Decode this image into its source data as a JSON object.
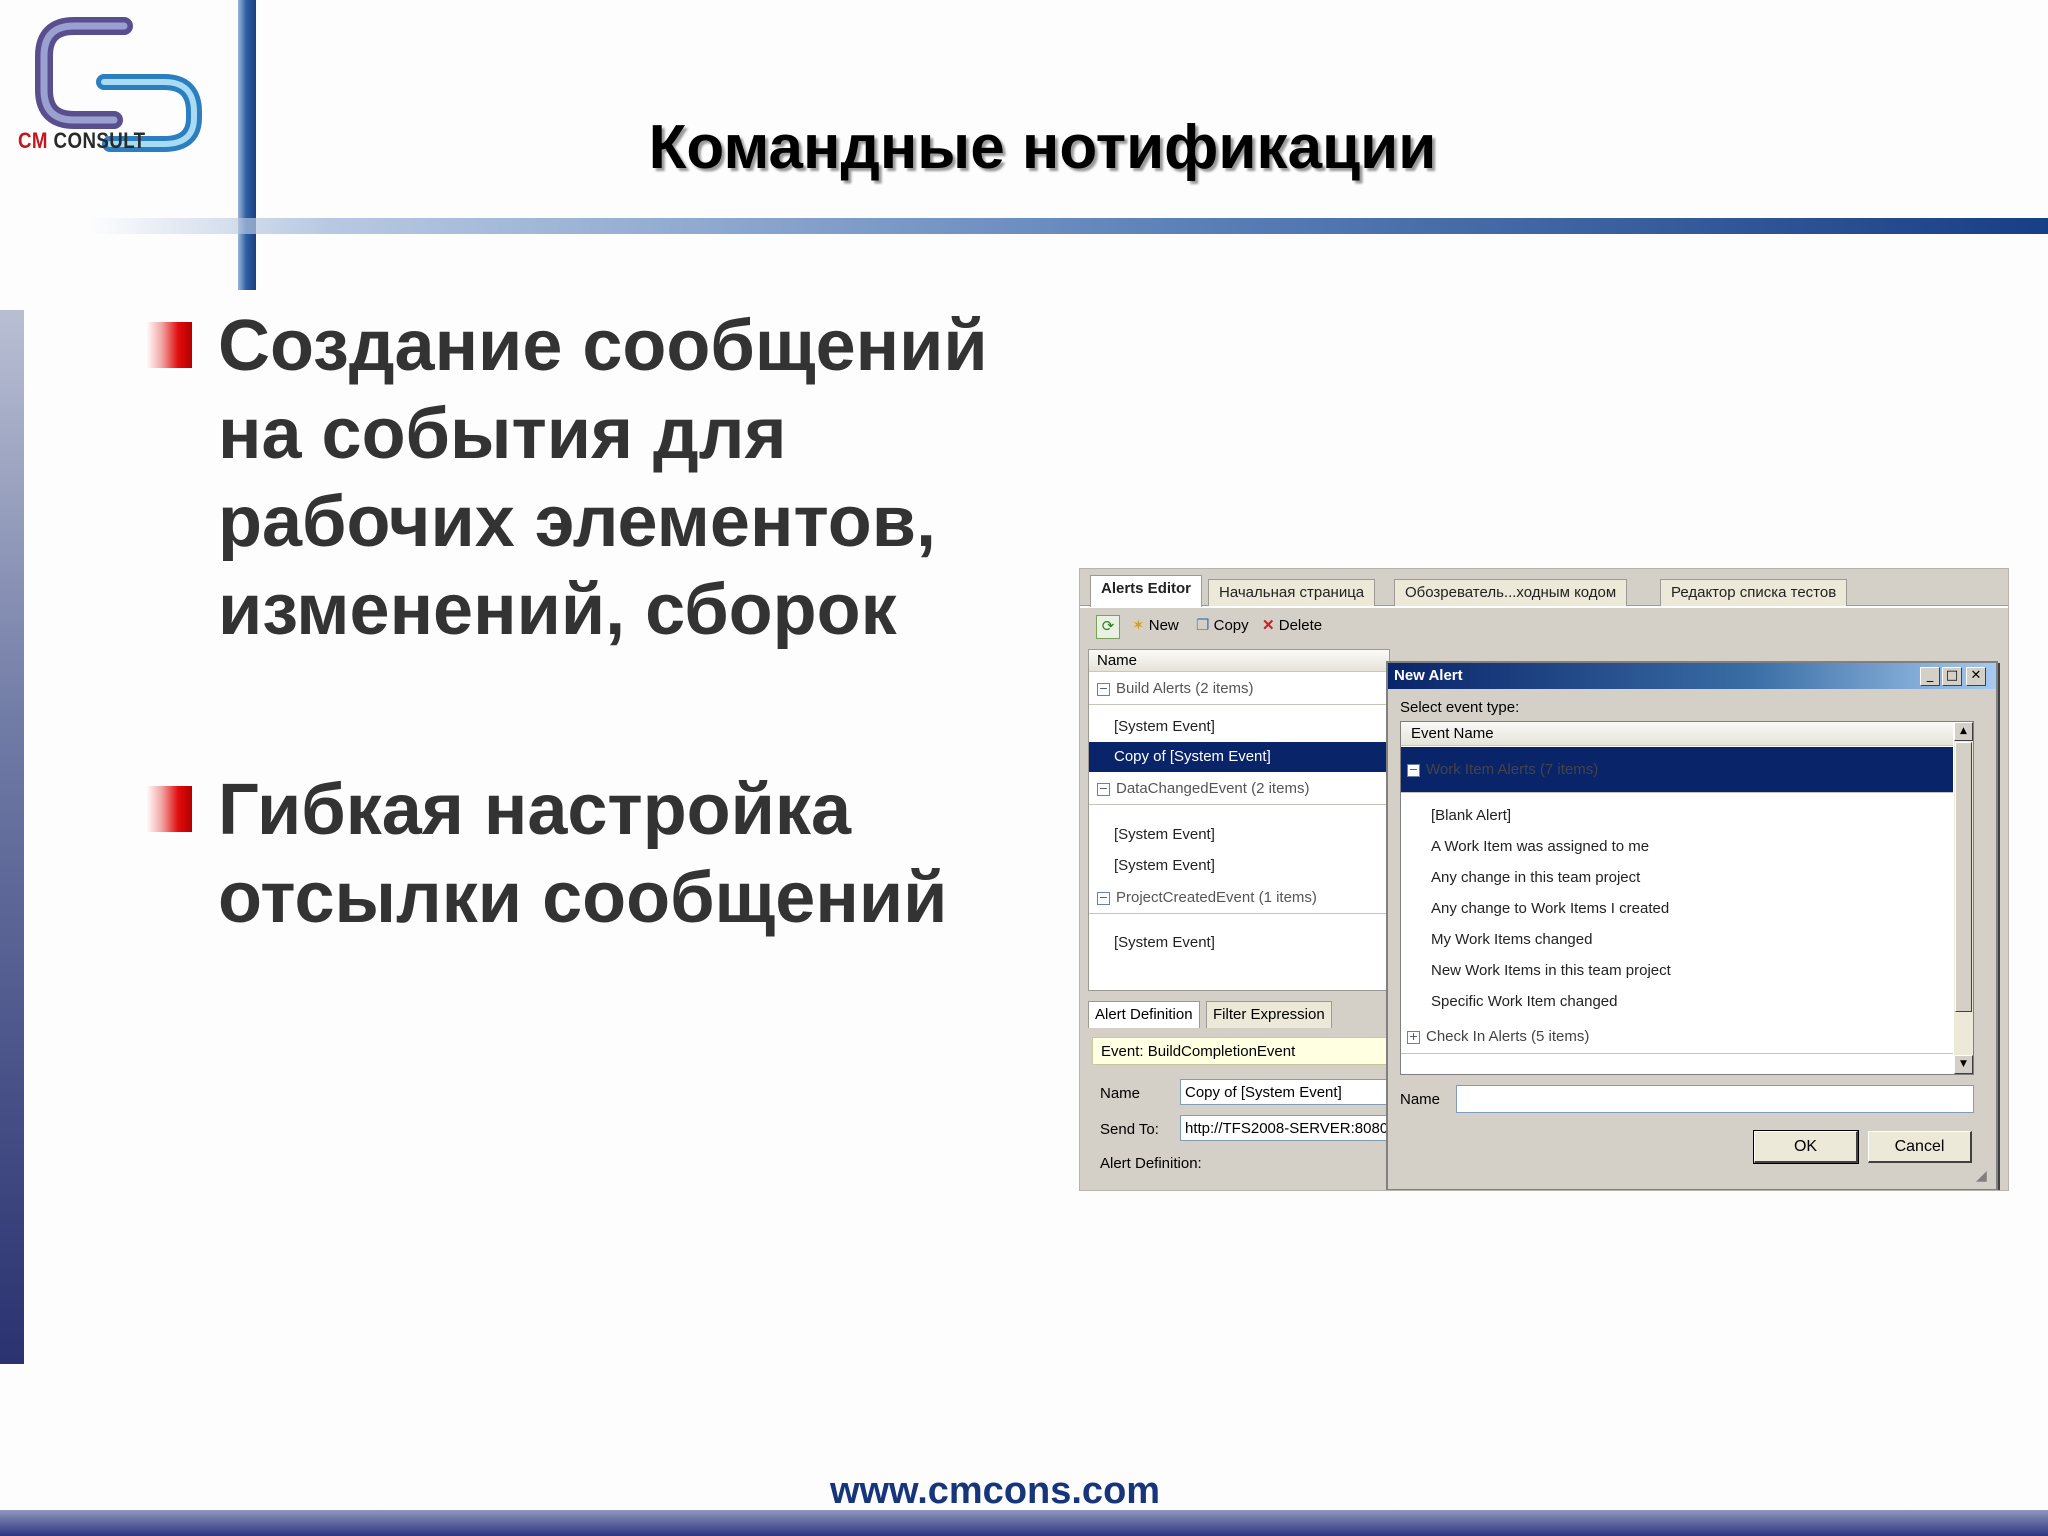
{
  "brand": {
    "cm": "CM",
    "consult": " CONSULT"
  },
  "slide": {
    "title": "Командные нотификации",
    "bullets": [
      "Создание сообщений на события для рабочих элементов, изменений, сборок",
      "Гибкая настройка отсылки сообщений"
    ],
    "footer_url": "www.cmcons.com"
  },
  "colors": {
    "accent_blue": "#1c3f7e",
    "bullet_red": "#e10d0d",
    "selection": "#0a246a"
  },
  "screenshot": {
    "tabs": [
      "Alerts Editor",
      "Начальная страница",
      "Обозреватель...ходным кодом",
      "Редактор списка тестов"
    ],
    "toolbar": {
      "new": "New",
      "copy": "Copy",
      "delete": "Delete"
    },
    "list": {
      "header": "Name",
      "groups": [
        {
          "label": "Build Alerts (2 items)",
          "items": [
            "[System Event]",
            "Copy of [System Event]"
          ]
        },
        {
          "label": "DataChangedEvent (2 items)",
          "items": [
            "[System Event]",
            "[System Event]"
          ]
        },
        {
          "label": "ProjectCreatedEvent (1 items)",
          "items": [
            "[System Event]"
          ]
        }
      ]
    },
    "lower_tabs": [
      "Alert Definition",
      "Filter Expression"
    ],
    "event_bar": "Event: BuildCompletionEvent",
    "fields": {
      "name_label": "Name",
      "name_value": "Copy of [System Event]",
      "send_to_label": "Send To:",
      "send_to_value": "http://TFS2008-SERVER:8080",
      "definition_label": "Alert Definition:"
    },
    "dialog": {
      "title": "New Alert",
      "select_label": "Select event type:",
      "column_header": "Event Name",
      "group_work_items": "Work Item Alerts (7 items)",
      "work_item_alerts": [
        "[Blank Alert]",
        "A Work Item was assigned to me",
        "Any change in this team project",
        "Any change to Work Items I created",
        "My Work Items changed",
        "New Work Items in this team project",
        "Specific Work Item changed"
      ],
      "group_check_in": "Check In Alerts (5 items)",
      "name_label": "Name",
      "name_value": "",
      "ok": "OK",
      "cancel": "Cancel"
    }
  }
}
